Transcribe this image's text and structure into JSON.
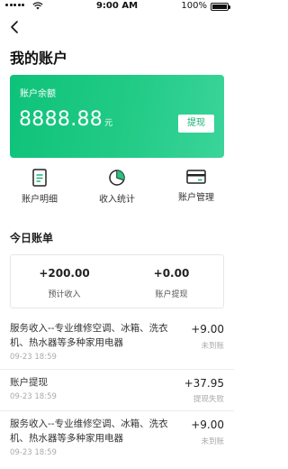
{
  "status_bar": {
    "time": "9:00 AM",
    "battery": "100%"
  },
  "header": {
    "title": "我的账户"
  },
  "balance": {
    "label": "账户余额",
    "amount": "8888.88",
    "unit": "元",
    "withdraw_label": "提现"
  },
  "shortcuts": [
    {
      "label": "账户明细",
      "icon": "document-list-icon"
    },
    {
      "label": "收入统计",
      "icon": "pie-chart-icon"
    },
    {
      "label": "账户管理",
      "icon": "card-icon"
    }
  ],
  "today": {
    "title": "今日账单",
    "summary": [
      {
        "value": "+200.00",
        "label": "预计收入"
      },
      {
        "value": "+0.00",
        "label": "账户提现"
      }
    ]
  },
  "transactions": [
    {
      "desc": "服务收入--专业维修空调、冰箱、洗衣机、热水器等多种家用电器",
      "date": "09-23 18:59",
      "amount": "+9.00",
      "status": "未到账"
    },
    {
      "desc": "账户提现",
      "date": "09-23 18:59",
      "amount": "+37.95",
      "status": "提现失败"
    },
    {
      "desc": "服务收入--专业维修空调、冰箱、洗衣机、热水器等多种家用电器",
      "date": "09-23 18:59",
      "amount": "+9.00",
      "status": "未到账"
    }
  ],
  "colors": {
    "accent": "#1cc580",
    "accent_text": "#15b072"
  }
}
